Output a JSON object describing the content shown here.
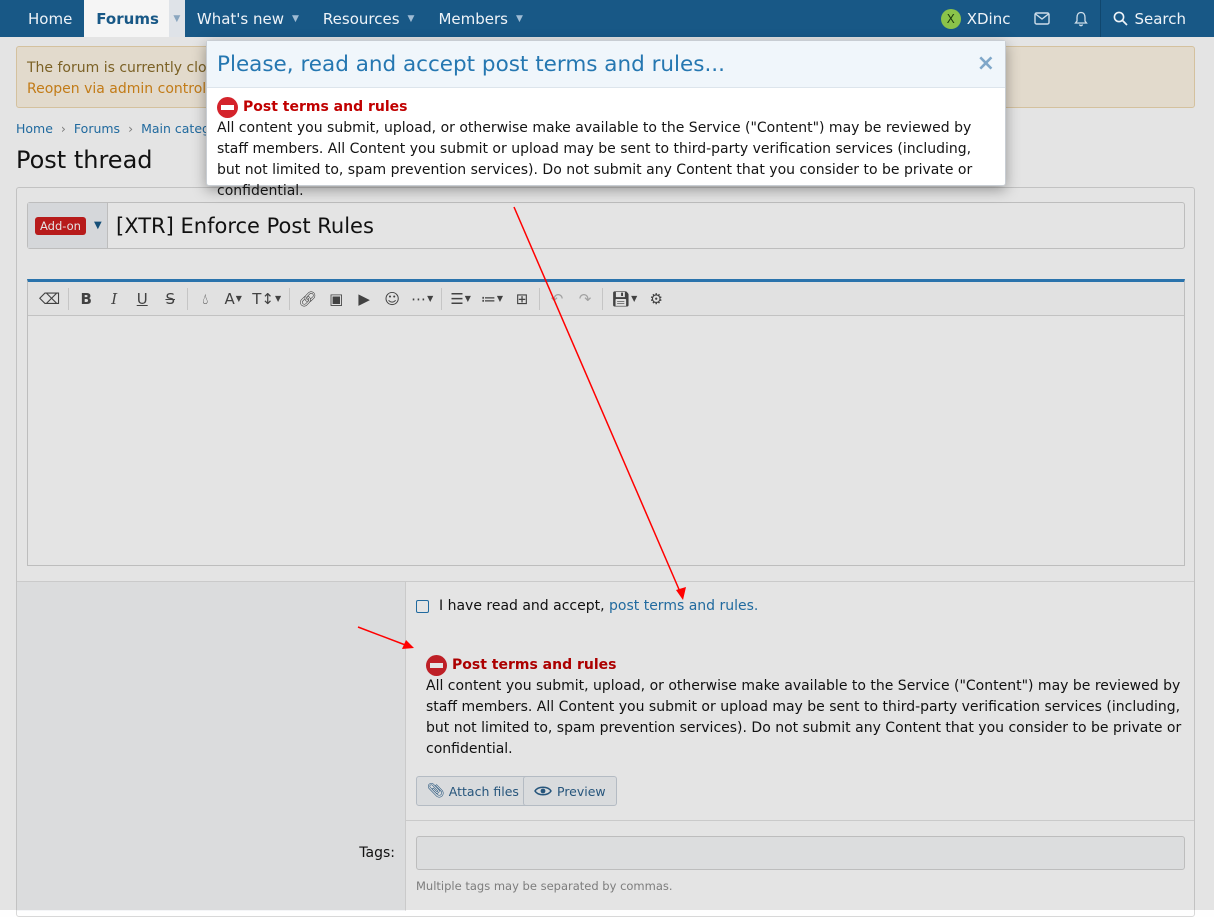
{
  "nav": {
    "items": [
      {
        "label": "Home"
      },
      {
        "label": "Forums"
      },
      {
        "label": "What's new"
      },
      {
        "label": "Resources"
      },
      {
        "label": "Members"
      }
    ],
    "user": {
      "initial": "X",
      "name": "XDinc"
    },
    "search_label": "Search"
  },
  "notice": {
    "line1": "The forum is currently closed",
    "line2": "Reopen via admin control panel"
  },
  "breadcrumb": [
    "Home",
    "Forums",
    "Main category"
  ],
  "page_title": "Post thread",
  "thread": {
    "prefix": "Add-on",
    "title": "[XTR] Enforce Post Rules"
  },
  "toolbar": {
    "icons": [
      "eraser-icon",
      "bold-icon",
      "italic-icon",
      "underline-icon",
      "strikethrough-icon",
      "color-icon",
      "font-family-icon",
      "font-size-icon",
      "link-icon",
      "image-icon",
      "media-icon",
      "smilie-icon",
      "more-icon",
      "align-icon",
      "list-icon",
      "table-icon",
      "undo-icon",
      "redo-icon",
      "drafts-icon",
      "settings-icon"
    ]
  },
  "terms": {
    "accept_prefix": "I have read and accept, ",
    "accept_link": "post terms and rules.",
    "heading": "Post terms and rules",
    "body": "All content you submit, upload, or otherwise make available to the Service (\"Content\") may be reviewed by staff members. All Content you submit or upload may be sent to third-party verification services (including, but not limited to, spam prevention services). Do not submit any Content that you consider to be private or confidential."
  },
  "buttons": {
    "attach": "Attach files",
    "preview": "Preview"
  },
  "tags": {
    "label": "Tags:",
    "hint": "Multiple tags may be separated by commas."
  },
  "modal": {
    "title": "Please, read and accept post terms and rules...",
    "close": "×"
  },
  "colors": {
    "nav_bg": "#185886",
    "link": "#2577b1",
    "rules_red": "#c00000",
    "annotation_arrow": "#ff0000"
  }
}
